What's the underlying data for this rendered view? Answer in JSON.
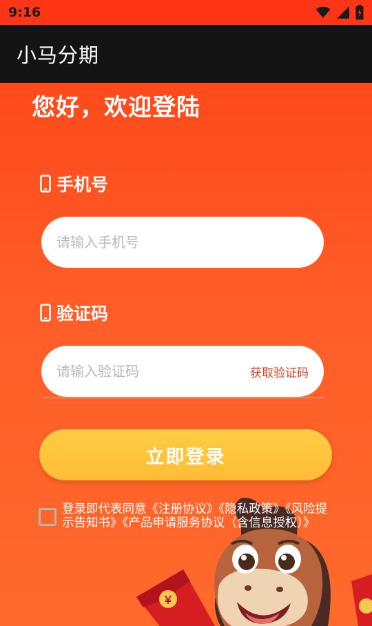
{
  "status_bar": {
    "time": "9:16",
    "icons": [
      "wifi-icon",
      "cell-signal-icon",
      "battery-icon"
    ]
  },
  "app_bar": {
    "title": "小马分期"
  },
  "welcome": "您好，欢迎登陆",
  "phone_field": {
    "label": "手机号",
    "icon": "mobile-phone-icon",
    "placeholder": "请输入手机号",
    "value": ""
  },
  "code_field": {
    "label": "验证码",
    "icon": "mobile-phone-icon",
    "placeholder": "请输入验证码",
    "value": "",
    "get_code_label": "获取验证码"
  },
  "login_button": {
    "label": "立即登录"
  },
  "agreement": {
    "checked": false,
    "text": "登录即代表同意《注册协议》《隐私政策》《风险提示告知书》《产品申请服务协议（含信息授权）》"
  },
  "colors": {
    "status_bar": "#ff3517",
    "app_bar": "#141414",
    "background": "#ff5a24",
    "button": "#ffc33d",
    "link_text": "#d2452a",
    "placeholder": "#b9b9b9"
  },
  "illustration": {
    "red_envelope_symbol": "￥",
    "mascot": "cartoon-horse"
  }
}
